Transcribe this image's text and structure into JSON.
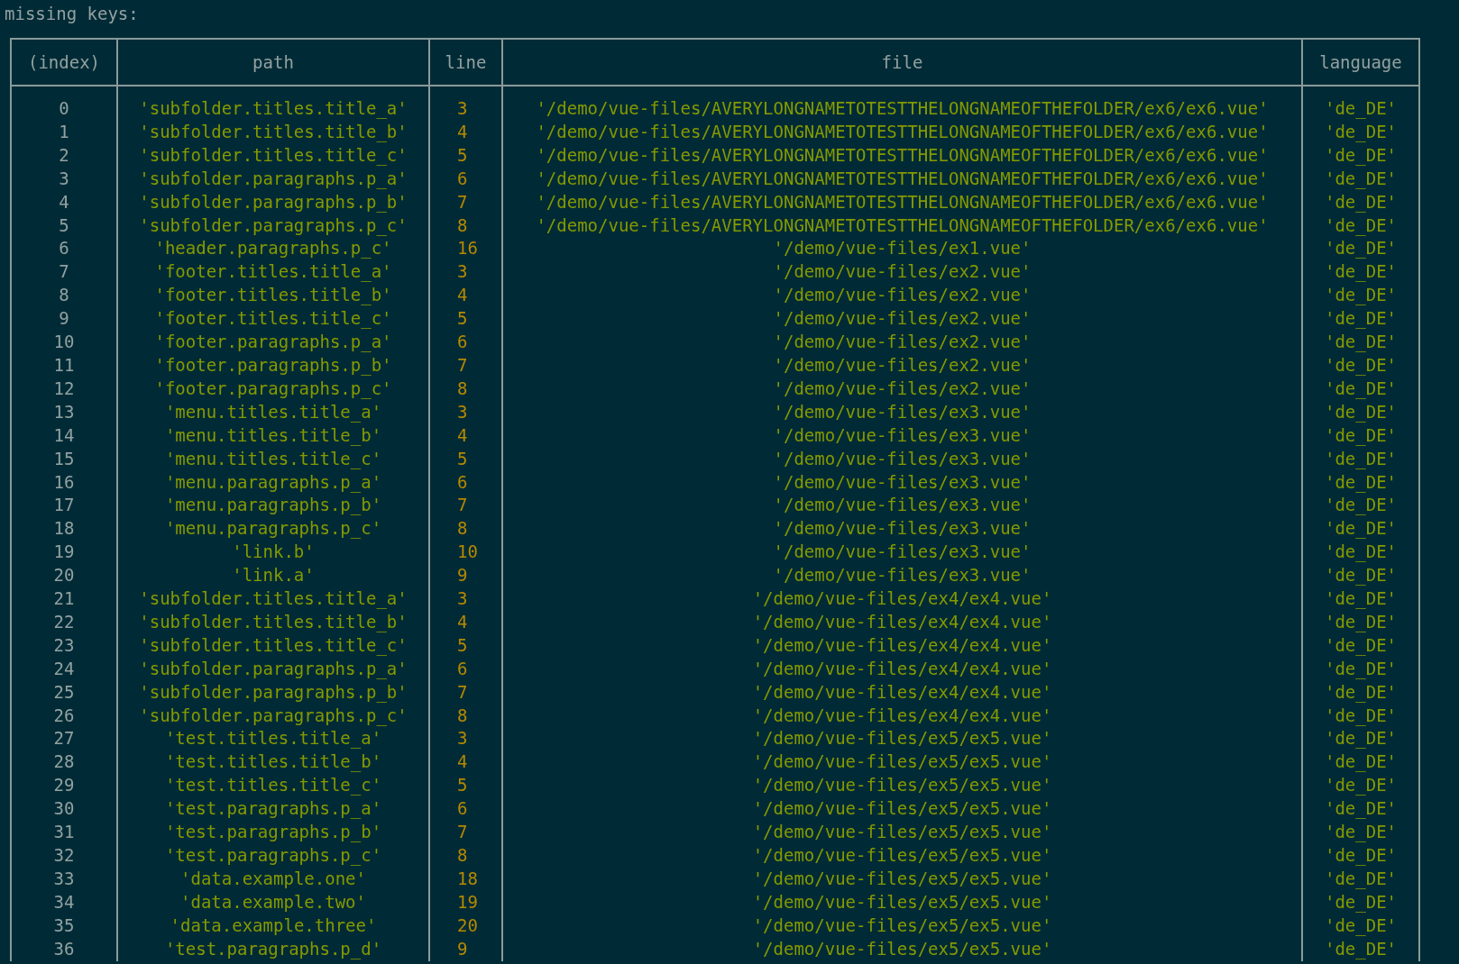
{
  "heading": "missing keys:",
  "table": {
    "columns": [
      {
        "label": "(index)",
        "kind": "index"
      },
      {
        "label": "path",
        "kind": "string"
      },
      {
        "label": "line",
        "kind": "number"
      },
      {
        "label": "file",
        "kind": "string"
      },
      {
        "label": "language",
        "kind": "string"
      }
    ],
    "rows": [
      [
        "0",
        "'subfolder.titles.title_a'",
        "3",
        "'/demo/vue-files/AVERYLONGNAMETOTESTTHELONGNAMEOFTHEFOLDER/ex6/ex6.vue'",
        "'de_DE'"
      ],
      [
        "1",
        "'subfolder.titles.title_b'",
        "4",
        "'/demo/vue-files/AVERYLONGNAMETOTESTTHELONGNAMEOFTHEFOLDER/ex6/ex6.vue'",
        "'de_DE'"
      ],
      [
        "2",
        "'subfolder.titles.title_c'",
        "5",
        "'/demo/vue-files/AVERYLONGNAMETOTESTTHELONGNAMEOFTHEFOLDER/ex6/ex6.vue'",
        "'de_DE'"
      ],
      [
        "3",
        "'subfolder.paragraphs.p_a'",
        "6",
        "'/demo/vue-files/AVERYLONGNAMETOTESTTHELONGNAMEOFTHEFOLDER/ex6/ex6.vue'",
        "'de_DE'"
      ],
      [
        "4",
        "'subfolder.paragraphs.p_b'",
        "7",
        "'/demo/vue-files/AVERYLONGNAMETOTESTTHELONGNAMEOFTHEFOLDER/ex6/ex6.vue'",
        "'de_DE'"
      ],
      [
        "5",
        "'subfolder.paragraphs.p_c'",
        "8",
        "'/demo/vue-files/AVERYLONGNAMETOTESTTHELONGNAMEOFTHEFOLDER/ex6/ex6.vue'",
        "'de_DE'"
      ],
      [
        "6",
        "'header.paragraphs.p_c'",
        "16",
        "'/demo/vue-files/ex1.vue'",
        "'de_DE'"
      ],
      [
        "7",
        "'footer.titles.title_a'",
        "3",
        "'/demo/vue-files/ex2.vue'",
        "'de_DE'"
      ],
      [
        "8",
        "'footer.titles.title_b'",
        "4",
        "'/demo/vue-files/ex2.vue'",
        "'de_DE'"
      ],
      [
        "9",
        "'footer.titles.title_c'",
        "5",
        "'/demo/vue-files/ex2.vue'",
        "'de_DE'"
      ],
      [
        "10",
        "'footer.paragraphs.p_a'",
        "6",
        "'/demo/vue-files/ex2.vue'",
        "'de_DE'"
      ],
      [
        "11",
        "'footer.paragraphs.p_b'",
        "7",
        "'/demo/vue-files/ex2.vue'",
        "'de_DE'"
      ],
      [
        "12",
        "'footer.paragraphs.p_c'",
        "8",
        "'/demo/vue-files/ex2.vue'",
        "'de_DE'"
      ],
      [
        "13",
        "'menu.titles.title_a'",
        "3",
        "'/demo/vue-files/ex3.vue'",
        "'de_DE'"
      ],
      [
        "14",
        "'menu.titles.title_b'",
        "4",
        "'/demo/vue-files/ex3.vue'",
        "'de_DE'"
      ],
      [
        "15",
        "'menu.titles.title_c'",
        "5",
        "'/demo/vue-files/ex3.vue'",
        "'de_DE'"
      ],
      [
        "16",
        "'menu.paragraphs.p_a'",
        "6",
        "'/demo/vue-files/ex3.vue'",
        "'de_DE'"
      ],
      [
        "17",
        "'menu.paragraphs.p_b'",
        "7",
        "'/demo/vue-files/ex3.vue'",
        "'de_DE'"
      ],
      [
        "18",
        "'menu.paragraphs.p_c'",
        "8",
        "'/demo/vue-files/ex3.vue'",
        "'de_DE'"
      ],
      [
        "19",
        "'link.b'",
        "10",
        "'/demo/vue-files/ex3.vue'",
        "'de_DE'"
      ],
      [
        "20",
        "'link.a'",
        "9",
        "'/demo/vue-files/ex3.vue'",
        "'de_DE'"
      ],
      [
        "21",
        "'subfolder.titles.title_a'",
        "3",
        "'/demo/vue-files/ex4/ex4.vue'",
        "'de_DE'"
      ],
      [
        "22",
        "'subfolder.titles.title_b'",
        "4",
        "'/demo/vue-files/ex4/ex4.vue'",
        "'de_DE'"
      ],
      [
        "23",
        "'subfolder.titles.title_c'",
        "5",
        "'/demo/vue-files/ex4/ex4.vue'",
        "'de_DE'"
      ],
      [
        "24",
        "'subfolder.paragraphs.p_a'",
        "6",
        "'/demo/vue-files/ex4/ex4.vue'",
        "'de_DE'"
      ],
      [
        "25",
        "'subfolder.paragraphs.p_b'",
        "7",
        "'/demo/vue-files/ex4/ex4.vue'",
        "'de_DE'"
      ],
      [
        "26",
        "'subfolder.paragraphs.p_c'",
        "8",
        "'/demo/vue-files/ex4/ex4.vue'",
        "'de_DE'"
      ],
      [
        "27",
        "'test.titles.title_a'",
        "3",
        "'/demo/vue-files/ex5/ex5.vue'",
        "'de_DE'"
      ],
      [
        "28",
        "'test.titles.title_b'",
        "4",
        "'/demo/vue-files/ex5/ex5.vue'",
        "'de_DE'"
      ],
      [
        "29",
        "'test.titles.title_c'",
        "5",
        "'/demo/vue-files/ex5/ex5.vue'",
        "'de_DE'"
      ],
      [
        "30",
        "'test.paragraphs.p_a'",
        "6",
        "'/demo/vue-files/ex5/ex5.vue'",
        "'de_DE'"
      ],
      [
        "31",
        "'test.paragraphs.p_b'",
        "7",
        "'/demo/vue-files/ex5/ex5.vue'",
        "'de_DE'"
      ],
      [
        "32",
        "'test.paragraphs.p_c'",
        "8",
        "'/demo/vue-files/ex5/ex5.vue'",
        "'de_DE'"
      ],
      [
        "33",
        "'data.example.one'",
        "18",
        "'/demo/vue-files/ex5/ex5.vue'",
        "'de_DE'"
      ],
      [
        "34",
        "'data.example.two'",
        "19",
        "'/demo/vue-files/ex5/ex5.vue'",
        "'de_DE'"
      ],
      [
        "35",
        "'data.example.three'",
        "20",
        "'/demo/vue-files/ex5/ex5.vue'",
        "'de_DE'"
      ],
      [
        "36",
        "'test.paragraphs.p_d'",
        "9",
        "'/demo/vue-files/ex5/ex5.vue'",
        "'de_DE'"
      ]
    ]
  }
}
